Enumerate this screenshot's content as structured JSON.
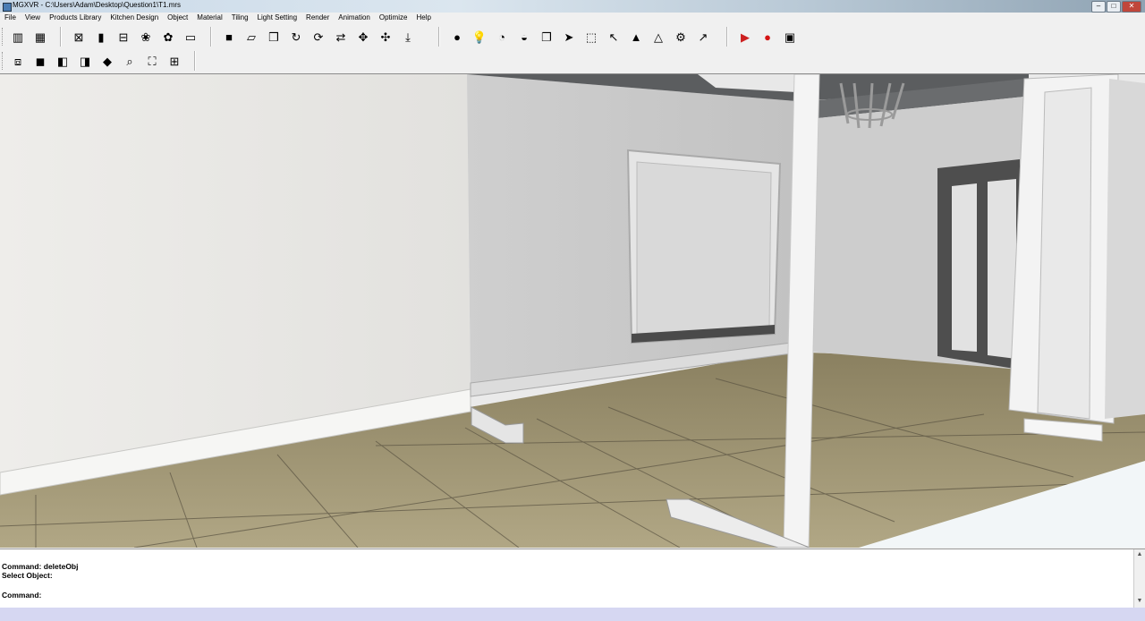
{
  "window": {
    "title": "MGXVR - C:\\Users\\Adam\\Desktop\\Question1\\T1.mrs",
    "minimize": "–",
    "maximize": "□",
    "close": "✕"
  },
  "menu": [
    "File",
    "View",
    "Products Library",
    "Kitchen Design",
    "Object",
    "Material",
    "Tiling",
    "Light Setting",
    "Render",
    "Animation",
    "Optimize",
    "Help"
  ],
  "toolbar1": {
    "group1": [
      {
        "name": "cabinet-icon",
        "glyph": "▥"
      },
      {
        "name": "cabinet-group-icon",
        "glyph": "▦"
      }
    ],
    "group2": [
      {
        "name": "delete-object-icon",
        "glyph": "⊠"
      },
      {
        "name": "color-bars-icon",
        "glyph": "▮"
      },
      {
        "name": "delete-bars-icon",
        "glyph": "⊟"
      },
      {
        "name": "plant-icon",
        "glyph": "❀"
      },
      {
        "name": "leaf-icon",
        "glyph": "✿"
      },
      {
        "name": "disabled-tool-icon",
        "glyph": "▭"
      }
    ],
    "group3": [
      {
        "name": "box-icon",
        "glyph": "■"
      },
      {
        "name": "plane-icon",
        "glyph": "▱"
      },
      {
        "name": "cube-icon",
        "glyph": "❒"
      },
      {
        "name": "rotate-icon",
        "glyph": "↻"
      },
      {
        "name": "orbit-icon",
        "glyph": "⟳"
      },
      {
        "name": "swap-icon",
        "glyph": "⇄"
      },
      {
        "name": "move-icon",
        "glyph": "✥"
      },
      {
        "name": "pan-icon",
        "glyph": "✣"
      },
      {
        "name": "import-icon",
        "glyph": "⤓"
      }
    ],
    "group4": [
      {
        "name": "color-balls-icon",
        "glyph": "●"
      },
      {
        "name": "light-bulb-icon",
        "glyph": "💡"
      },
      {
        "name": "spotlight-icon",
        "glyph": "◔"
      },
      {
        "name": "lamp-icon",
        "glyph": "◒"
      },
      {
        "name": "copy-icon",
        "glyph": "❐"
      },
      {
        "name": "select-arrow-icon",
        "glyph": "➤"
      },
      {
        "name": "select-box-icon",
        "glyph": "⬚"
      },
      {
        "name": "select-cursor-icon",
        "glyph": "↖"
      },
      {
        "name": "triangle-icon",
        "glyph": "▲"
      },
      {
        "name": "triangle-outline-icon",
        "glyph": "△"
      },
      {
        "name": "gear-icon",
        "glyph": "⚙"
      },
      {
        "name": "pointer-plus-icon",
        "glyph": "↗"
      }
    ],
    "group5": [
      {
        "name": "play-icon",
        "glyph": "▶",
        "color": "#cc1f1f"
      },
      {
        "name": "record-icon",
        "glyph": "●",
        "color": "#d41414"
      },
      {
        "name": "camera-icon",
        "glyph": "▣"
      }
    ]
  },
  "toolbar2": [
    {
      "name": "view-top-icon",
      "glyph": "⧈"
    },
    {
      "name": "view-front-icon",
      "glyph": "◼"
    },
    {
      "name": "view-side-icon",
      "glyph": "◧"
    },
    {
      "name": "view-back-icon",
      "glyph": "◨"
    },
    {
      "name": "view-iso-icon",
      "glyph": "◆"
    },
    {
      "name": "zoom-icon",
      "glyph": "⌕"
    },
    {
      "name": "zoom-extents-icon",
      "glyph": "⛶"
    },
    {
      "name": "zoom-window-icon",
      "glyph": "⊞"
    }
  ],
  "command": {
    "line1": "Command: deleteObj",
    "line2": "Select Object:",
    "line3": "",
    "line4": "Command:"
  }
}
